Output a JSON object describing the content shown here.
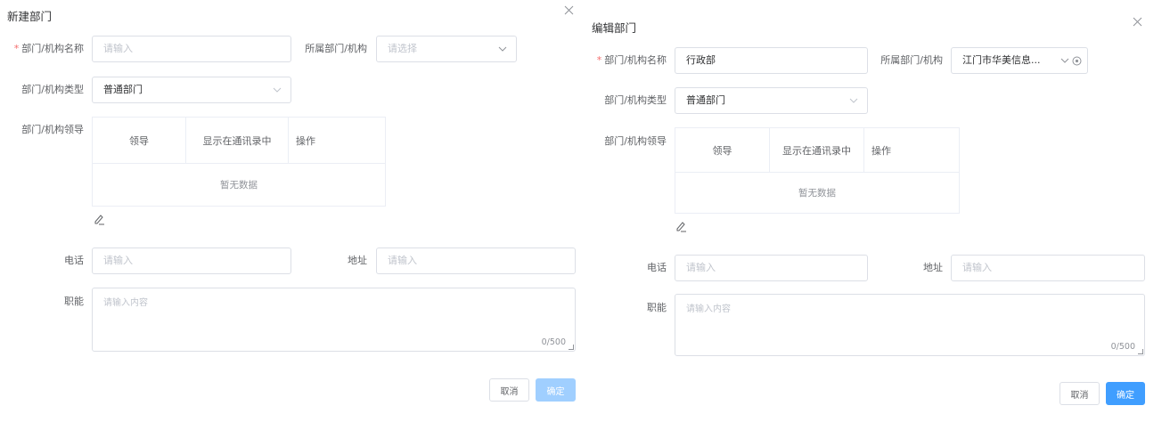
{
  "colors": {
    "primary": "#409eff",
    "primary_disabled": "#a0cfff",
    "required": "#f56c6c",
    "border": "#dcdfe6",
    "placeholder": "#c0c4cc"
  },
  "create_dialog": {
    "title": "新建部门",
    "close_icon": "close-icon",
    "required_mark": "*",
    "name_label": "部门/机构名称",
    "name_placeholder": "请输入",
    "parent_label": "所属部门/机构",
    "parent_placeholder": "请选择",
    "type_label": "部门/机构类型",
    "type_value": "普通部门",
    "leader_label": "部门/机构领导",
    "table": {
      "columns": [
        "领导",
        "显示在通讯录中",
        "操作"
      ],
      "empty_text": "暂无数据"
    },
    "phone_label": "电话",
    "phone_placeholder": "请输入",
    "address_label": "地址",
    "address_placeholder": "请输入",
    "function_label": "职能",
    "function_placeholder": "请输入内容",
    "function_count": "0/500",
    "cancel_label": "取消",
    "confirm_label": "确定"
  },
  "edit_dialog": {
    "title": "编辑部门",
    "close_icon": "close-icon",
    "required_mark": "*",
    "name_label": "部门/机构名称",
    "name_value": "行政部",
    "parent_label": "所属部门/机构",
    "parent_value": "江门市华美信息...",
    "type_label": "部门/机构类型",
    "type_value": "普通部门",
    "leader_label": "部门/机构领导",
    "table": {
      "columns": [
        "领导",
        "显示在通讯录中",
        "操作"
      ],
      "empty_text": "暂无数据"
    },
    "phone_label": "电话",
    "phone_placeholder": "请输入",
    "address_label": "地址",
    "address_placeholder": "请输入",
    "function_label": "职能",
    "function_placeholder": "请输入内容",
    "function_count": "0/500",
    "cancel_label": "取消",
    "confirm_label": "确定"
  }
}
